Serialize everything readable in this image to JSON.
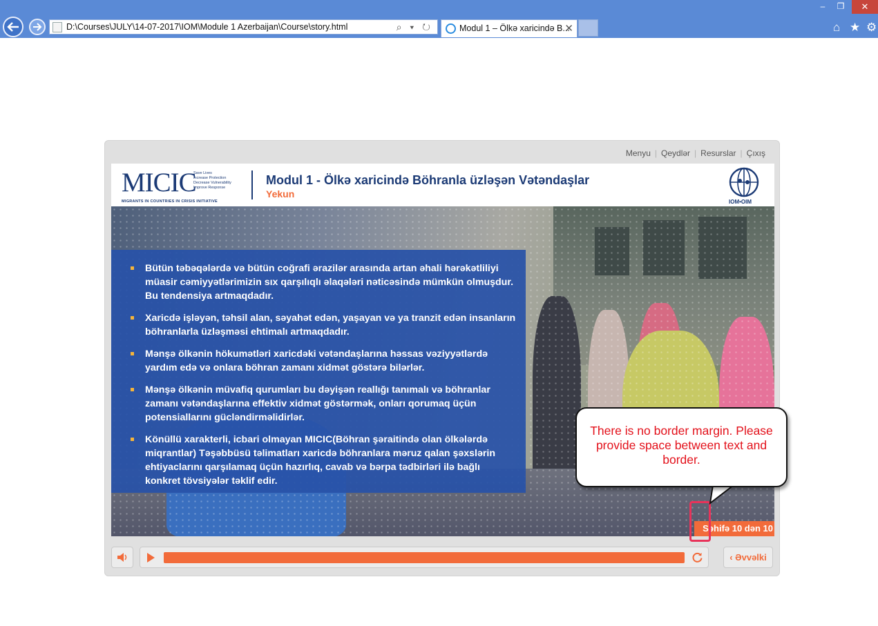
{
  "browser": {
    "address_url": "D:\\Courses\\JULY\\14-07-2017\\IOM\\Module 1 Azerbaijan\\Course\\story.html",
    "address_tools": "⌕ ▾ ↻",
    "tab_title": "Modul 1 – Ölkə xaricində B...",
    "tab_close": "✕",
    "window_minimize": "–",
    "window_restore": "❐",
    "window_close": "✕",
    "home_icon": "⌂",
    "favorites_icon": "★",
    "settings_icon": "⚙"
  },
  "player": {
    "top_menu": [
      "Menyu",
      "Qeydlər",
      "Resurslar",
      "Çıxış"
    ],
    "progress_fraction": 1.0,
    "prev_label": "‹ Əvvəlki",
    "page_counter": "Səhifə 10 dən 10"
  },
  "slide": {
    "logo_word": "MICIC",
    "logo_tagline_lines": [
      "Save Lives",
      "Increase Protection",
      "Decrease Vulnerability",
      "Improve Response"
    ],
    "logo_subline": "MIGRANTS IN COUNTRIES IN CRISIS INITIATIVE",
    "title": "Modul 1 - Ölkə xaricində Böhranla üzləşən Vətəndaşlar",
    "subtitle": "Yekun",
    "iom_logo_text": "IOM•OIM",
    "bullets": [
      "Bütün təbəqələrdə və bütün coğrafi ərazilər arasında artan əhali hərəkətliliyi müasir cəmiyyətlərimizin sıx qarşılıqlı əlaqələri nəticəsində mümkün olmuşdur. Bu tendensiya artmaqdadır.",
      "Xaricdə işləyən, təhsil alan, səyahət edən, yaşayan və ya tranzit edən insanların böhranlarla üzləşməsi ehtimalı artmaqdadır.",
      "Mənşə ölkənin hökumətləri xaricdəki vətəndaşlarına həssas vəziyyətlərdə yardım edə və onlara böhran zamanı xidmət göstərə bilərlər.",
      "Mənşə ölkənin müvafiq qurumları bu dəyişən reallığı tanımalı və böhranlar zamanı vətəndaşlarına effektiv xidmət göstərmək, onları qorumaq üçün potensiallarını gücləndirməlidirlər.",
      "Könüllü xarakterli, icbari olmayan MICIC(Böhran şəraitində olan ölkələrdə miqrantlar) Təşəbbüsü təlimatları xaricdə böhranlara məruz qalan şəxslərin ehtiyaclarını qarşılamaq üçün hazırlıq, cavab və bərpa tədbirləri ilə bağlı konkret tövsiyələr təklif edir."
    ]
  },
  "review_callout": {
    "text": "There is no border margin. Please provide space between text and border."
  },
  "colors": {
    "accent_orange": "#f26b3a",
    "panel_blue": "#2852a8",
    "brand_navy": "#1b3a75",
    "callout_red": "#e3101a",
    "highlight_pink": "#e8335a"
  }
}
